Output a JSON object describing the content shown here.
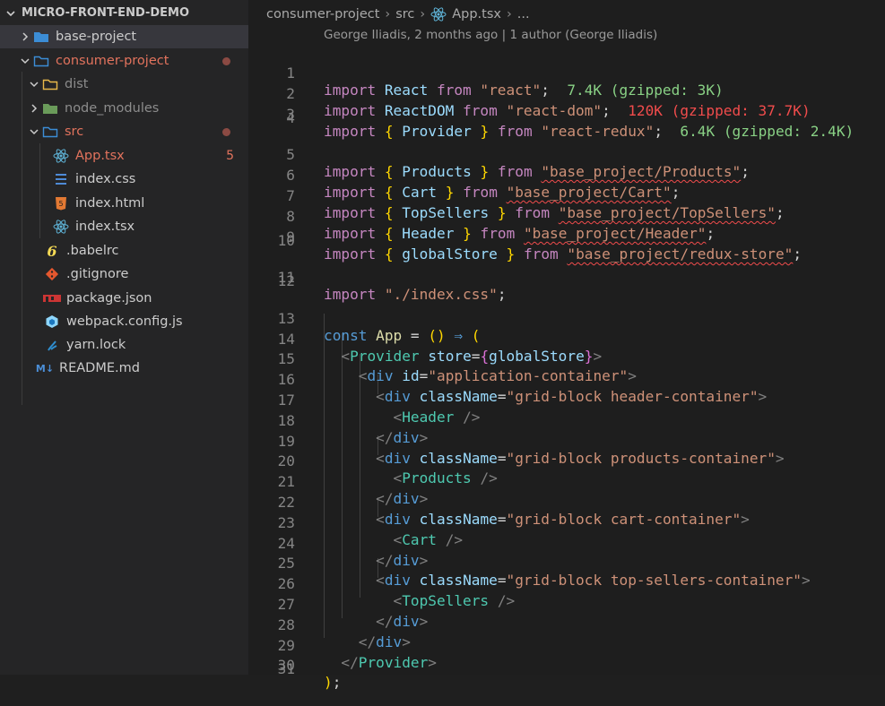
{
  "explorer": {
    "title": "MICRO-FRONT-END-DEMO",
    "items": [
      {
        "label": "base-project",
        "color": "#cccccc"
      },
      {
        "label": "consumer-project",
        "color": "#e2735d"
      },
      {
        "label": "dist",
        "color": "#8c8c8c"
      },
      {
        "label": "node_modules",
        "color": "#8c8c8c"
      },
      {
        "label": "src",
        "color": "#e2735d"
      },
      {
        "label": "App.tsx",
        "color": "#e2735d",
        "badge": "5"
      },
      {
        "label": "index.css",
        "color": "#cccccc"
      },
      {
        "label": "index.html",
        "color": "#cccccc"
      },
      {
        "label": "index.tsx",
        "color": "#cccccc"
      },
      {
        "label": ".babelrc",
        "color": "#cccccc"
      },
      {
        "label": ".gitignore",
        "color": "#cccccc"
      },
      {
        "label": "package.json",
        "color": "#cccccc"
      },
      {
        "label": "webpack.config.js",
        "color": "#cccccc"
      },
      {
        "label": "yarn.lock",
        "color": "#cccccc"
      },
      {
        "label": "README.md",
        "color": "#cccccc"
      }
    ]
  },
  "breadcrumb": {
    "project": "consumer-project",
    "folder": "src",
    "file": "App.tsx",
    "more": "..."
  },
  "blame": "George Iliadis, 2 months ago | 1 author (George Iliadis)",
  "code": {
    "line_numbers": [
      "1",
      "2",
      "3",
      "4",
      "5",
      "6",
      "7",
      "8",
      "9",
      "10",
      "11",
      "12",
      "13",
      "14",
      "15",
      "16",
      "17",
      "18",
      "19",
      "20",
      "21",
      "22",
      "23",
      "24",
      "25",
      "26",
      "27",
      "28",
      "29",
      "30",
      "31"
    ],
    "l1": {
      "a": "import",
      "b": " React ",
      "c": "from",
      "d": " \"react\"",
      "e": ";",
      "cost": "7.4K (gzipped: 3K)"
    },
    "l2": {
      "a": "import",
      "b": " ReactDOM ",
      "c": "from",
      "d": " \"react-dom\"",
      "e": ";",
      "cost": "120K (gzipped: 37.7K)"
    },
    "l3": {
      "a": "import",
      "b": "{",
      "c": "Provider",
      "d": "}",
      "e": "from",
      "f": "\"react-redux\"",
      "g": ";",
      "cost": "6.4K (gzipped: 2.4K)"
    },
    "l5": {
      "name": "Products",
      "src": "\"base_project/Products\""
    },
    "l6": {
      "name": "Cart",
      "src": "\"base_project/Cart\""
    },
    "l7": {
      "name": "TopSellers",
      "src": "\"base_project/TopSellers\""
    },
    "l8": {
      "name": "Header",
      "src": "\"base_project/Header\""
    },
    "l9": {
      "name": "globalStore",
      "src": "\"base_project/redux-store\""
    },
    "l11": {
      "src": "\"./index.css\""
    },
    "l13": {
      "kw": "const",
      "name": "App",
      "eq": " = ",
      "paren": "()",
      "arrow": " ⇒ ",
      "open": "("
    },
    "l14": {
      "tag": "Provider",
      "attr": "store",
      "val": "globalStore"
    },
    "l15": {
      "tag": "div",
      "attr": "id",
      "val": "\"application-container\""
    },
    "l16": {
      "tag": "div",
      "attr": "className",
      "val": "\"grid-block header-container\""
    },
    "l17": {
      "comp": "Header"
    },
    "l18": {
      "tag": "div"
    },
    "l19": {
      "tag": "div",
      "attr": "className",
      "val": "\"grid-block products-container\""
    },
    "l20": {
      "comp": "Products"
    },
    "l21": {
      "tag": "div"
    },
    "l22": {
      "tag": "div",
      "attr": "className",
      "val": "\"grid-block cart-container\""
    },
    "l23": {
      "comp": "Cart"
    },
    "l24": {
      "tag": "div"
    },
    "l25": {
      "tag": "div",
      "attr": "className",
      "val": "\"grid-block top-sellers-container\""
    },
    "l26": {
      "comp": "TopSellers"
    },
    "l27": {
      "tag": "div"
    },
    "l28": {
      "tag": "div"
    },
    "l29": {
      "tag": "Provider"
    },
    "l30": {
      "close": ")",
      "semi": ";"
    }
  },
  "colors": {
    "folder": "#3c8dd6",
    "react": "#5fb4d8",
    "css": "#4e8ad6",
    "html": "#e37933",
    "babel": "#f5da55",
    "git": "#e4572e",
    "npm": "#cc3534",
    "webpack": "#8ed6fb",
    "yarn": "#2f8ecf",
    "md": "#4b8ed6"
  }
}
